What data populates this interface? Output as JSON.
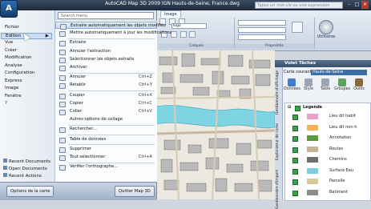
{
  "window": {
    "title": "AutoCAD Map 3D 2009  IGN Hauts-de-Seine, France.dwg",
    "search_placeholder": "Tapez un mot-clé ou une expression",
    "app_logo_letter": "A"
  },
  "ribbon": {
    "tabs": [
      "Image"
    ],
    "active_tab": "Image",
    "layer_dropdown": "logo",
    "groups": [
      {
        "label": "Calques"
      },
      {
        "label": "Propriétés"
      }
    ],
    "utilities_label": "Utilitaires"
  },
  "app_menu": {
    "search_placeholder": "Search menu",
    "left_items": [
      {
        "label": "Fichier"
      },
      {
        "label": "Edition",
        "selected": true,
        "arrow": "▶"
      },
      {
        "label": "Vue"
      },
      {
        "label": "Créer"
      },
      {
        "label": "Modification"
      },
      {
        "label": "Analyse"
      },
      {
        "label": "Configuration"
      },
      {
        "label": "Express"
      },
      {
        "label": "Image"
      },
      {
        "label": "Fenêtre"
      },
      {
        "label": "?"
      }
    ],
    "submenu": [
      {
        "label": "Extraire automatiquement les objets modifiés",
        "shortcut": "",
        "icon": "extract-auto-icon",
        "highlight": true
      },
      {
        "label": "Mettre automatiquement à jour les modifications",
        "shortcut": "",
        "icon": "auto-update-icon"
      },
      {
        "label": "Extraire",
        "shortcut": "",
        "icon": "extract-icon"
      },
      {
        "label": "Annuler l'extraction",
        "shortcut": "",
        "icon": "cancel-extract-icon"
      },
      {
        "label": "Sélectionner les objets extraits",
        "shortcut": "",
        "icon": "select-extracted-icon"
      },
      {
        "label": "Archiver",
        "shortcut": "",
        "icon": "archive-icon"
      },
      {
        "label": "Annuler",
        "shortcut": "Ctrl+Z",
        "icon": "undo-icon"
      },
      {
        "label": "Rétablir",
        "shortcut": "Ctrl+Y",
        "icon": "redo-icon"
      },
      {
        "label": "Couper",
        "shortcut": "Ctrl+X",
        "icon": "cut-icon"
      },
      {
        "label": "Copier",
        "shortcut": "Ctrl+C",
        "icon": "copy-icon"
      },
      {
        "label": "Coller",
        "shortcut": "Ctrl+V",
        "icon": "paste-icon"
      },
      {
        "label": "Autres options de collage",
        "shortcut": "",
        "icon": ""
      },
      {
        "label": "Rechercher...",
        "shortcut": "",
        "icon": "find-icon"
      },
      {
        "label": "Table de données",
        "shortcut": "",
        "icon": "data-table-icon"
      },
      {
        "label": "Supprimer",
        "shortcut": "",
        "icon": "delete-icon"
      },
      {
        "label": "Tout sélectionner",
        "shortcut": "Ctrl+A",
        "icon": "select-all-icon"
      },
      {
        "label": "Vérifier l'orthographe...",
        "shortcut": "",
        "icon": "spellcheck-icon"
      }
    ],
    "bottom_items": [
      {
        "label": "Recent Documents"
      },
      {
        "label": "Open Documents"
      },
      {
        "label": "Recent Actions"
      }
    ],
    "options_button": "Options de la carte",
    "quit_button": "Quitter Map 3D"
  },
  "task_pane": {
    "title": "Volet Tâches",
    "vertical_tabs": [
      "Gestionnaire d'affichage",
      "Explorateur de carte",
      "Gestionnaire d'import"
    ],
    "carte_label": "Carte courante:",
    "carte_value": "Hauts-de-Seine",
    "tools": [
      {
        "label": "Données",
        "icon": "data-icon",
        "color": "#3e7fc7"
      },
      {
        "label": "Style",
        "icon": "style-icon",
        "color": "#9aa6b5"
      },
      {
        "label": "Table",
        "icon": "table-icon",
        "color": "#9aa6b5"
      },
      {
        "label": "Groupes",
        "icon": "groups-icon",
        "color": "#5fa15f"
      },
      {
        "label": "Outils",
        "icon": "tools-icon",
        "color": "#8a6a3b"
      }
    ],
    "legend_title": "Legende",
    "legend_items": [
      {
        "label": "Lieu dit habit",
        "swatch": "#e6a0c9"
      },
      {
        "label": "Lieu dit non-h",
        "swatch": "#f0b45a"
      },
      {
        "label": "Annotation",
        "swatch": "#5b9b3a"
      },
      {
        "label": "Routes",
        "swatch": "#c7b299"
      },
      {
        "label": "Chemins",
        "swatch": "#6f6f6f"
      },
      {
        "label": "Surface Eau",
        "swatch": "#78cfe0"
      },
      {
        "label": "Parcelle",
        "swatch": "#d9c89a"
      },
      {
        "label": "Batiment",
        "swatch": "#8c8c8c"
      }
    ]
  }
}
